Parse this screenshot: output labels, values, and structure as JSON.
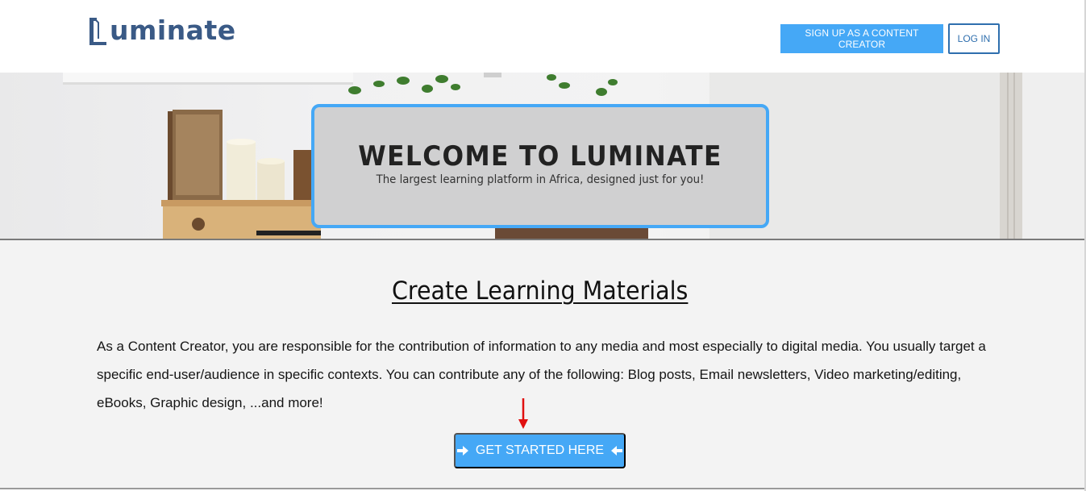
{
  "header": {
    "logo_text": "uminate",
    "logo_mark": "L",
    "signup_label": "SIGN UP AS A CONTENT CREATOR",
    "login_label": "LOG IN"
  },
  "hero": {
    "title": "WELCOME TO LUMINATE",
    "subtitle": "The largest learning platform in Africa, designed just for you!"
  },
  "main": {
    "title": "Create Learning Materials",
    "description": "As a Content Creator, you are responsible for the contribution of information to any media and most especially to digital media. You usually target a specific end-user/audience in specific contexts. You can contribute any of the following: Blog posts, Email newsletters, Video marketing/editing, eBooks, Graphic design, ...and more!",
    "cta_label": "GET STARTED HERE",
    "cta_icons": [
      "arrow-right-icon",
      "arrow-left-icon"
    ]
  },
  "colors": {
    "brand_blue": "#45a8f6",
    "logo_navy": "#3a5a86",
    "login_blue": "#2f6fae",
    "annotation_red": "#e01010"
  }
}
